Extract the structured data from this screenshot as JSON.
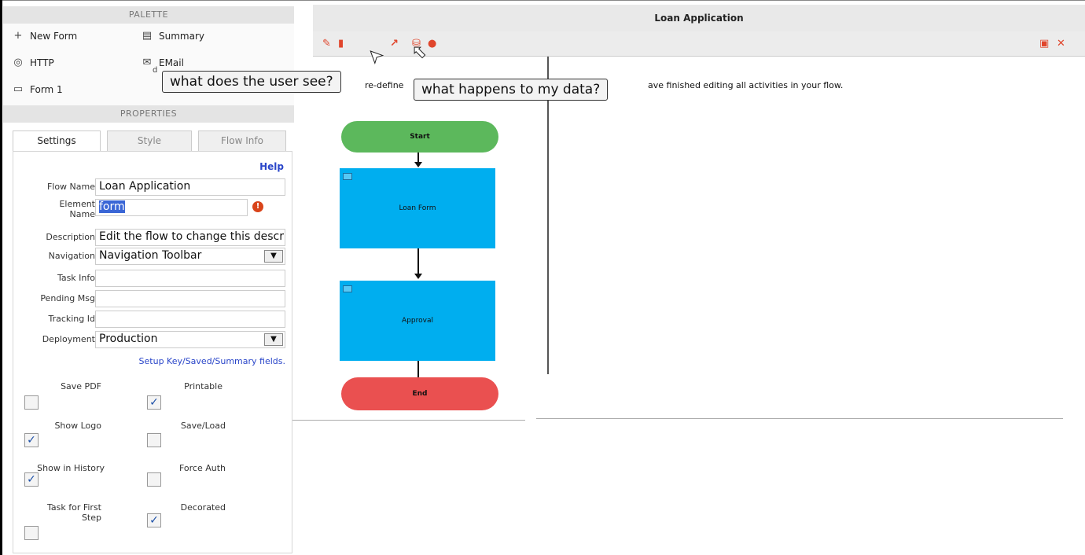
{
  "palette": {
    "heading": "PALETTE",
    "items": [
      {
        "label": "New Form",
        "icon": "plus-icon"
      },
      {
        "label": "Summary",
        "icon": "summary-icon"
      },
      {
        "label": "HTTP",
        "icon": "globe-icon"
      },
      {
        "label": "EMail",
        "icon": "email-icon"
      },
      {
        "label": "Form 1",
        "icon": "form-icon"
      }
    ],
    "partial_text": "d"
  },
  "properties": {
    "heading": "PROPERTIES",
    "tabs": [
      "Settings",
      "Style",
      "Flow Info"
    ],
    "help": "Help",
    "fields": {
      "flow_name": {
        "label": "Flow Name",
        "value": "Loan Application"
      },
      "element_name": {
        "label": "Element Name",
        "value": "form"
      },
      "description": {
        "label": "Description",
        "value": "Edit the flow to change this descrip"
      },
      "navigation": {
        "label": "Navigation",
        "value": "Navigation Toolbar"
      },
      "task_info": {
        "label": "Task Info",
        "value": ""
      },
      "pending_msg": {
        "label": "Pending Msg",
        "value": ""
      },
      "tracking_id": {
        "label": "Tracking Id",
        "value": ""
      },
      "deployment": {
        "label": "Deployment",
        "value": "Production"
      }
    },
    "setup_link": "Setup Key/Saved/Summary fields.",
    "checkboxes": [
      {
        "label": "Save PDF",
        "checked": false
      },
      {
        "label": "Printable",
        "checked": true
      },
      {
        "label": "Show Logo",
        "checked": true
      },
      {
        "label": "Save/Load",
        "checked": false
      },
      {
        "label": "Show in History",
        "checked": true
      },
      {
        "label": "Force Auth",
        "checked": false
      },
      {
        "label": "Task for First Step",
        "checked": false
      },
      {
        "label": "Decorated",
        "checked": true
      }
    ],
    "check_glyph": "✓"
  },
  "canvas": {
    "title": "Loan Application",
    "toolbar_icons": [
      "pencil-icon",
      "document-icon",
      "external-link-icon",
      "database-icon",
      "lock-icon",
      "save-icon",
      "close-icon"
    ],
    "desc_left": "re-define",
    "desc_right": "ave finished editing all activities in your flow.",
    "nodes": {
      "start": "Start",
      "form": "Loan Form",
      "approval": "Approval",
      "end": "End"
    }
  },
  "callouts": {
    "user_sees": "what does the user see?",
    "my_data": "what happens to my data?"
  },
  "colors": {
    "start": "#5cb85c",
    "task": "#00aeef",
    "end": "#ea5050",
    "toolbar_accent": "#e0452b",
    "link": "#2a46c9"
  }
}
